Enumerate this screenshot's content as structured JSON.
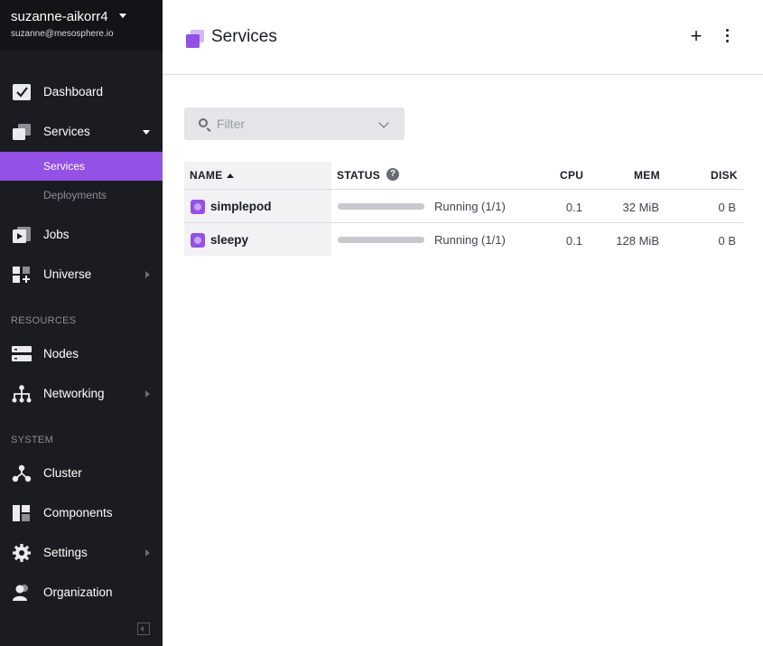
{
  "user": {
    "name": "suzanne-aikorr4",
    "email": "suzanne@mesosphere.io"
  },
  "sidebar": {
    "items": [
      {
        "label": "Dashboard",
        "icon": "dashboard-icon"
      },
      {
        "label": "Services",
        "icon": "services-icon",
        "expanded": true,
        "children": [
          {
            "label": "Services",
            "active": true
          },
          {
            "label": "Deployments",
            "active": false
          }
        ]
      },
      {
        "label": "Jobs",
        "icon": "jobs-icon"
      },
      {
        "label": "Universe",
        "icon": "universe-icon",
        "has_submenu": true
      }
    ],
    "sections": [
      {
        "heading": "RESOURCES",
        "items": [
          {
            "label": "Nodes",
            "icon": "nodes-icon"
          },
          {
            "label": "Networking",
            "icon": "networking-icon",
            "has_submenu": true
          }
        ]
      },
      {
        "heading": "SYSTEM",
        "items": [
          {
            "label": "Cluster",
            "icon": "cluster-icon"
          },
          {
            "label": "Components",
            "icon": "components-icon"
          },
          {
            "label": "Settings",
            "icon": "settings-icon",
            "has_submenu": true
          },
          {
            "label": "Organization",
            "icon": "organization-icon"
          }
        ]
      }
    ]
  },
  "header": {
    "title": "Services",
    "add_label": "+"
  },
  "filter": {
    "placeholder": "Filter",
    "value": ""
  },
  "table": {
    "columns": {
      "name": "NAME",
      "status": "STATUS",
      "status_help": "?",
      "cpu": "CPU",
      "mem": "MEM",
      "disk": "DISK"
    },
    "rows": [
      {
        "name": "simplepod",
        "status": "Running (1/1)",
        "cpu": "0.1",
        "mem": "32 MiB",
        "disk": "0 B"
      },
      {
        "name": "sleepy",
        "status": "Running (1/1)",
        "cpu": "0.1",
        "mem": "128 MiB",
        "disk": "0 B"
      }
    ]
  },
  "colors": {
    "sidebar_bg": "#1b1c22",
    "accent": "#9351e5",
    "header_border": "#dcdce1"
  }
}
